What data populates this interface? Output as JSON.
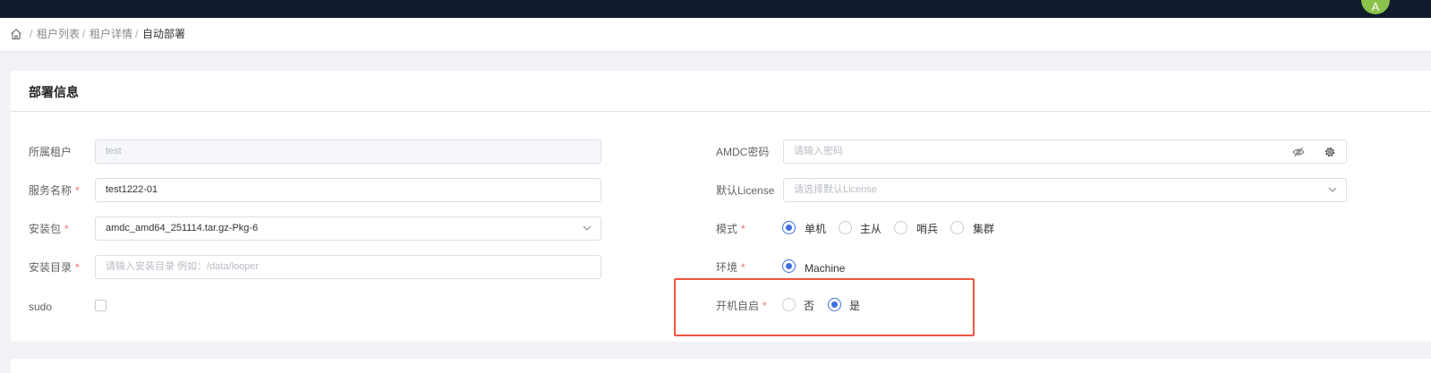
{
  "header": {
    "avatar_text": "A"
  },
  "breadcrumb": {
    "items": [
      "租户列表",
      "租户详情",
      "自动部署"
    ],
    "separator": "/"
  },
  "card": {
    "title": "部署信息"
  },
  "form_left": {
    "tenant": {
      "label": "所属租户",
      "value": "test"
    },
    "service_name": {
      "label": "服务名称",
      "value": "test1222-01"
    },
    "package": {
      "label": "安装包",
      "value": "amdc_amd64_251114.tar.gz-Pkg-6"
    },
    "install_dir": {
      "label": "安装目录",
      "placeholder": "请输入安装目录 例如：/data/looper"
    },
    "sudo": {
      "label": "sudo",
      "checked": false
    }
  },
  "form_right": {
    "password": {
      "label": "AMDC密码",
      "placeholder": "请输入密码"
    },
    "license": {
      "label": "默认License",
      "placeholder": "请选择默认License"
    },
    "mode": {
      "label": "模式",
      "options": [
        "单机",
        "主从",
        "哨兵",
        "集群"
      ],
      "selected": "单机"
    },
    "env": {
      "label": "环境",
      "options": [
        "Machine"
      ],
      "selected": "Machine"
    },
    "autostart": {
      "label": "开机自启",
      "options": [
        "否",
        "是"
      ],
      "selected": "是"
    }
  },
  "required_mark": "*",
  "colors": {
    "topbar": "#101b2d",
    "accent": "#3f6fe0",
    "required": "#f56c6c",
    "highlight": "#f1543f"
  }
}
